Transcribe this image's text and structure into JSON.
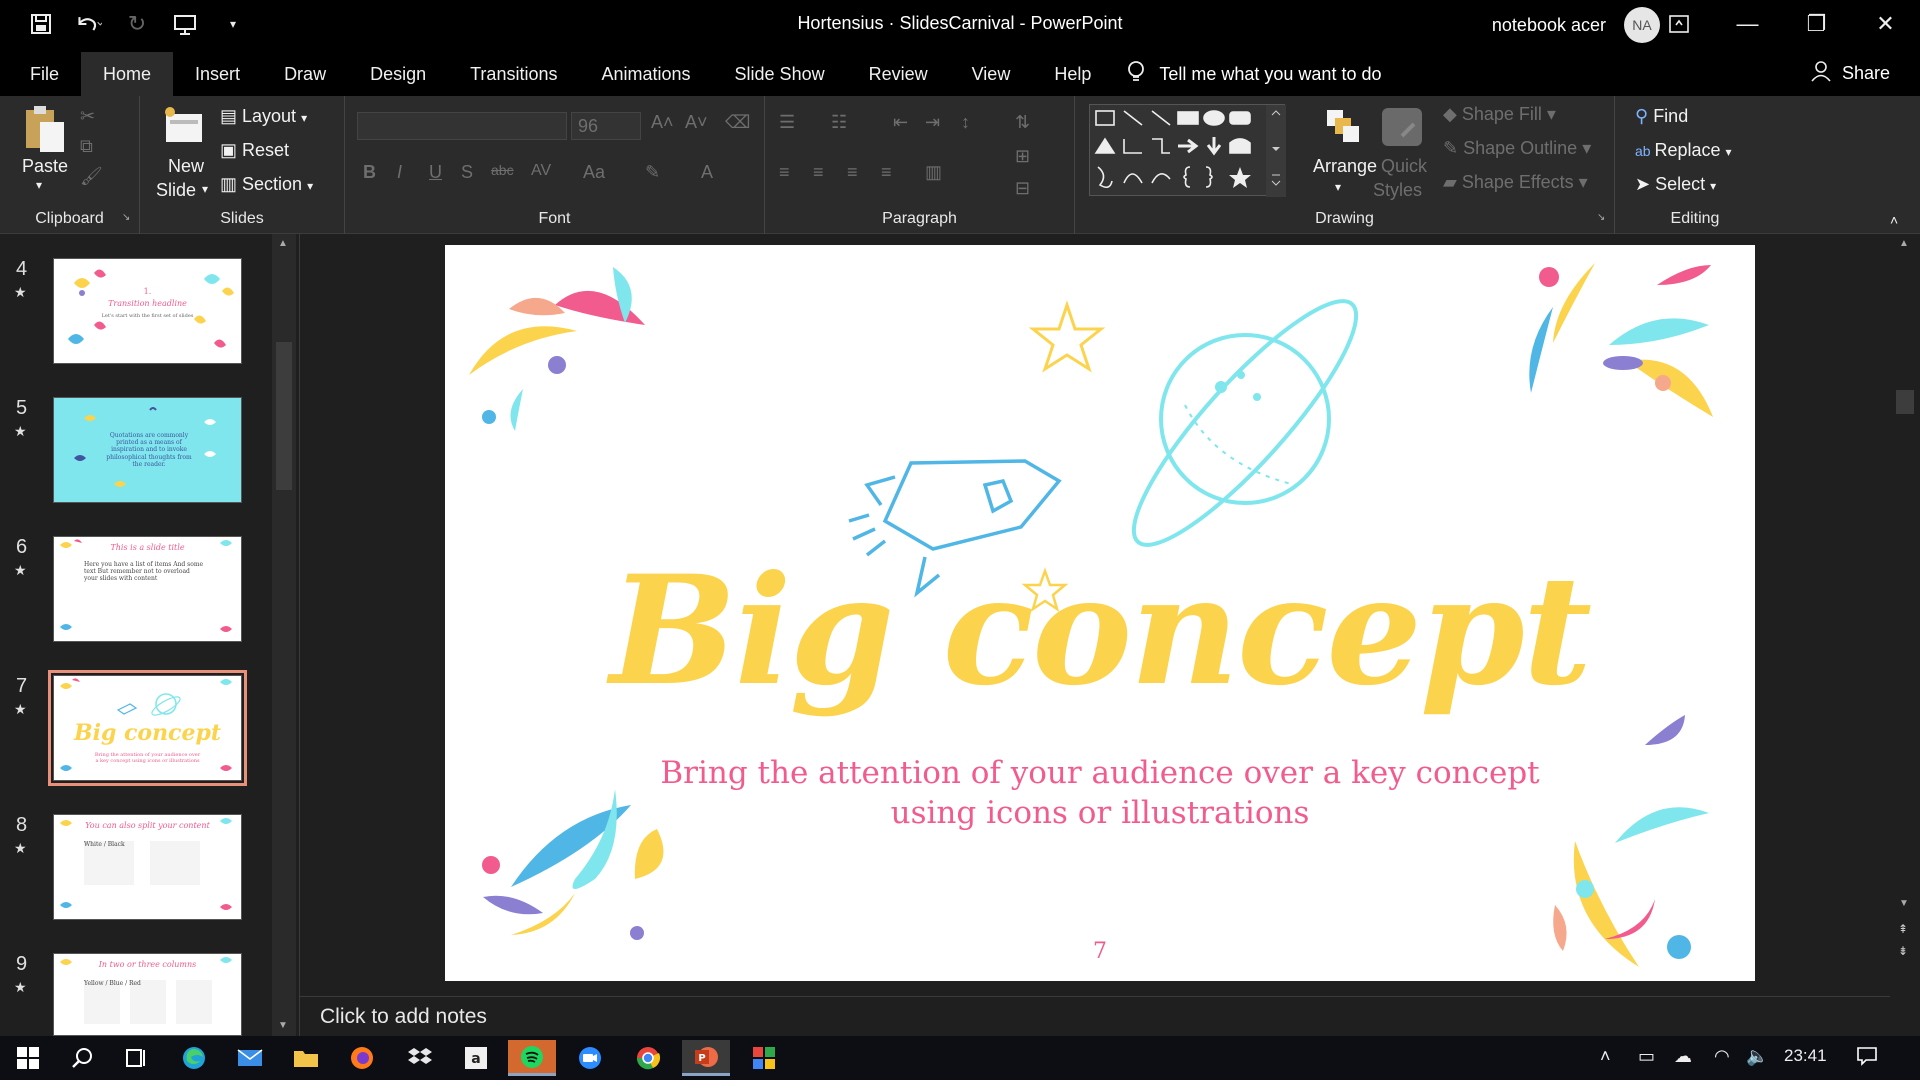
{
  "window": {
    "title": "Hortensius · SlidesCarnival  -  PowerPoint",
    "user_name": "notebook acer",
    "avatar_initials": "NA"
  },
  "menu": {
    "tabs": [
      "File",
      "Home",
      "Insert",
      "Draw",
      "Design",
      "Transitions",
      "Animations",
      "Slide Show",
      "Review",
      "View",
      "Help"
    ],
    "active_tab": "Home",
    "tell_me": "Tell me what you want to do",
    "share": "Share"
  },
  "ribbon": {
    "clipboard": {
      "paste": "Paste",
      "label": "Clipboard"
    },
    "slides": {
      "new_slide_line1": "New",
      "new_slide_line2": "Slide",
      "layout": "Layout",
      "reset": "Reset",
      "section": "Section",
      "label": "Slides"
    },
    "font": {
      "size": "96",
      "label": "Font"
    },
    "paragraph": {
      "label": "Paragraph"
    },
    "drawing": {
      "arrange": "Arrange",
      "quick_styles_line1": "Quick",
      "quick_styles_line2": "Styles",
      "shape_fill": "Shape Fill",
      "shape_outline": "Shape Outline",
      "shape_effects": "Shape Effects",
      "label": "Drawing"
    },
    "editing": {
      "find": "Find",
      "replace": "Replace",
      "select": "Select",
      "label": "Editing"
    }
  },
  "thumbnails": [
    {
      "num": "4",
      "title": "Transition headline",
      "number_line": "1.",
      "body": "Let's start with the first set of slides"
    },
    {
      "num": "5",
      "title": "",
      "body": "Quotations are commonly printed as a means of inspiration and to invoke philosophical thoughts from the reader."
    },
    {
      "num": "6",
      "title": "This is a slide title",
      "body": "Here you have a list of items And some text But remember not to overload your slides with content"
    },
    {
      "num": "7",
      "title": "Big concept",
      "body": "Bring the attention of your audience over a key concept using icons or illustrations"
    },
    {
      "num": "8",
      "title": "You can also split your content",
      "body": "White / Black"
    },
    {
      "num": "9",
      "title": "In two or three columns",
      "body": "Yellow / Blue / Red"
    }
  ],
  "slide": {
    "title": "Big concept",
    "subtitle_line1": "Bring the attention of your audience over a key concept",
    "subtitle_line2": "using icons or illustrations",
    "page_number": "7"
  },
  "notes_placeholder": "Click to add notes",
  "taskbar": {
    "time": "23:41"
  },
  "colors": {
    "title_yellow": "#fcd34d",
    "accent_pink": "#f25b8d",
    "accent_cyan": "#7ee6ec",
    "accent_blue": "#4fb6e6",
    "thumb_selected": "#e8907a"
  }
}
